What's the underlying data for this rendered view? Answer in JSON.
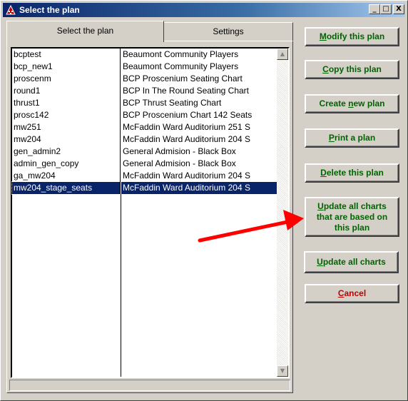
{
  "window": {
    "title": "Select the plan",
    "controls": {
      "minimize": "_",
      "maximize": "□",
      "close": "X"
    }
  },
  "tabs": [
    {
      "label": "Select the plan",
      "active": true
    },
    {
      "label": "Settings",
      "active": false
    }
  ],
  "plans": [
    {
      "name": "bcptest",
      "description": "Beaumont Community Players"
    },
    {
      "name": "bcp_new1",
      "description": "Beaumont Community Players"
    },
    {
      "name": "proscenm",
      "description": "BCP Proscenium Seating Chart"
    },
    {
      "name": "round1",
      "description": "BCP In The Round Seating Chart"
    },
    {
      "name": "thrust1",
      "description": "BCP Thrust Seating Chart"
    },
    {
      "name": "prosc142",
      "description": "BCP Proscenium Chart 142 Seats"
    },
    {
      "name": "mw251",
      "description": "McFaddin Ward Auditorium 251 S"
    },
    {
      "name": "mw204",
      "description": "McFaddin Ward Auditorium 204 S"
    },
    {
      "name": "gen_admin2",
      "description": "General Admision - Black Box"
    },
    {
      "name": "admin_gen_copy",
      "description": "General Admision - Black Box"
    },
    {
      "name": "ga_mw204",
      "description": "McFaddin Ward Auditorium 204 S"
    },
    {
      "name": "mw204_stage_seats",
      "description": "McFaddin Ward Auditorium 204 S",
      "selected": true
    }
  ],
  "buttons": {
    "modify": {
      "before": "",
      "accel": "M",
      "after": "odify this plan"
    },
    "copy": {
      "before": "",
      "accel": "C",
      "after": "opy this plan"
    },
    "create": {
      "before": "Create ",
      "accel": "n",
      "after": "ew plan"
    },
    "print": {
      "before": "",
      "accel": "P",
      "after": "rint a plan"
    },
    "delete": {
      "before": "",
      "accel": "D",
      "after": "elete this plan"
    },
    "update_based": {
      "before": "",
      "accel": "U",
      "after": "pdate all charts that are based on this plan"
    },
    "update_all": {
      "before": "",
      "accel": "U",
      "after": "pdate all charts"
    },
    "cancel": {
      "before": "",
      "accel": "C",
      "after": "ancel"
    }
  },
  "colors": {
    "button_text": "#006400",
    "cancel_text": "#c00000",
    "selection": "#0a246a",
    "annotation_arrow": "#ff0000"
  },
  "scrollbar_icons": {
    "up": "triangle-up-icon",
    "down": "triangle-down-icon"
  }
}
